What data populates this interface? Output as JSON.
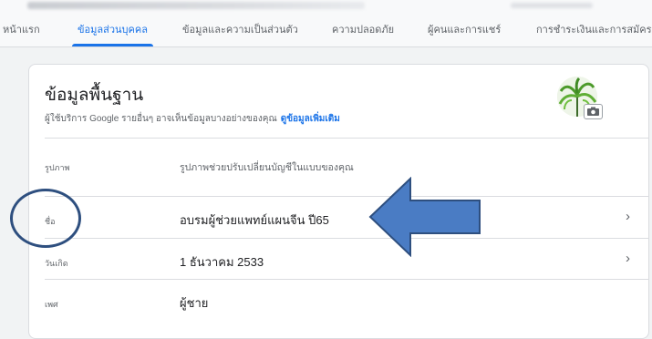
{
  "tabs": [
    {
      "label": "หน้าแรก"
    },
    {
      "label": "ข้อมูลส่วนบุคคล",
      "active": true
    },
    {
      "label": "ข้อมูลและความเป็นส่วนตัว"
    },
    {
      "label": "ความปลอดภัย"
    },
    {
      "label": "ผู้คนและการแชร์"
    },
    {
      "label": "การชำระเงินและการสมัครรับ"
    }
  ],
  "card": {
    "title": "ข้อมูลพื้นฐาน",
    "subtitle": "ผู้ใช้บริการ Google รายอื่นๆ อาจเห็นข้อมูลบางอย่างของคุณ",
    "more_link": "ดูข้อมูลเพิ่มเติม",
    "rows": [
      {
        "label": "รูปภาพ",
        "value": "รูปภาพช่วยปรับเปลี่ยนบัญชีในแบบของคุณ"
      },
      {
        "label": "ชื่อ",
        "value": "อบรมผู้ช่วยแพทย์แผนจีน ปี65"
      },
      {
        "label": "วันเกิด",
        "value": "1 ธันวาคม 2533"
      },
      {
        "label": "เพศ",
        "value": "ผู้ชาย"
      }
    ],
    "chevron": "›"
  },
  "colors": {
    "accent": "#1a73e8",
    "annotation_circle": "#2e4f7f",
    "annotation_arrow": "#4a7cc4"
  },
  "icons": {
    "avatar": "profile-photo-plant",
    "camera": "camera-icon",
    "chevron": "chevron-right-icon"
  }
}
